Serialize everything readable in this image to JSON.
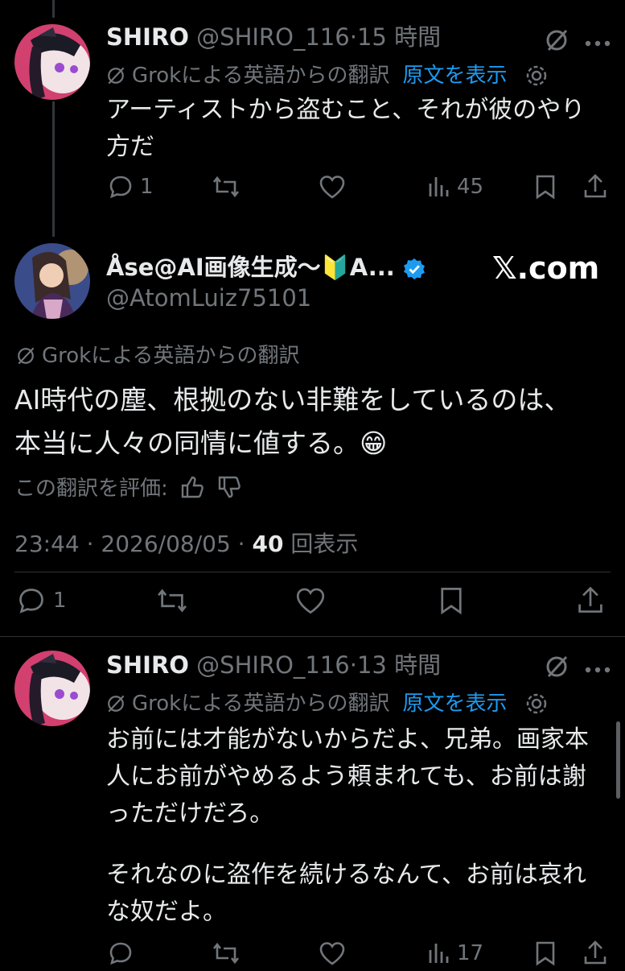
{
  "watermark": "𝕏.com",
  "colors": {
    "background": "#000000",
    "text": "#e7e9ea",
    "muted": "#71767b",
    "link": "#1d9bf0",
    "verified": "#1d9bf0"
  },
  "reply1": {
    "display_name": "SHIRO",
    "handle": "@SHIRO_116",
    "separator": "·",
    "time": "15 時間",
    "translation_label": "Grokによる英語からの翻訳",
    "show_original": "原文を表示",
    "text": "アーティストから盗むこと、それが彼のやり方だ",
    "reply_count": "1",
    "views_count": "45"
  },
  "main": {
    "display_name": "Åse@AI画像生成〜🔰A...",
    "handle": "@AtomLuiz75101",
    "translation_label": "Grokによる英語からの翻訳",
    "text": "AI時代の塵、根拠のない非難をしているのは、本当に人々の同情に値する。😁",
    "rate_label": "この翻訳を評価:",
    "timestamp": "23:44 · 2026/08/05 · ",
    "views_number": "40",
    "views_label": " 回表示",
    "reply_count": "1"
  },
  "reply2": {
    "display_name": "SHIRO",
    "handle": "@SHIRO_116",
    "separator": "·",
    "time": "13 時間",
    "translation_label": "Grokによる英語からの翻訳",
    "show_original": "原文を表示",
    "text_p1": "お前には才能がないからだよ、兄弟。画家本人にお前がやめるよう頼まれても、お前は謝っただけだろ。",
    "text_p2": "それなのに盗作を続けるなんて、お前は哀れな奴だよ。",
    "views_count": "17"
  }
}
